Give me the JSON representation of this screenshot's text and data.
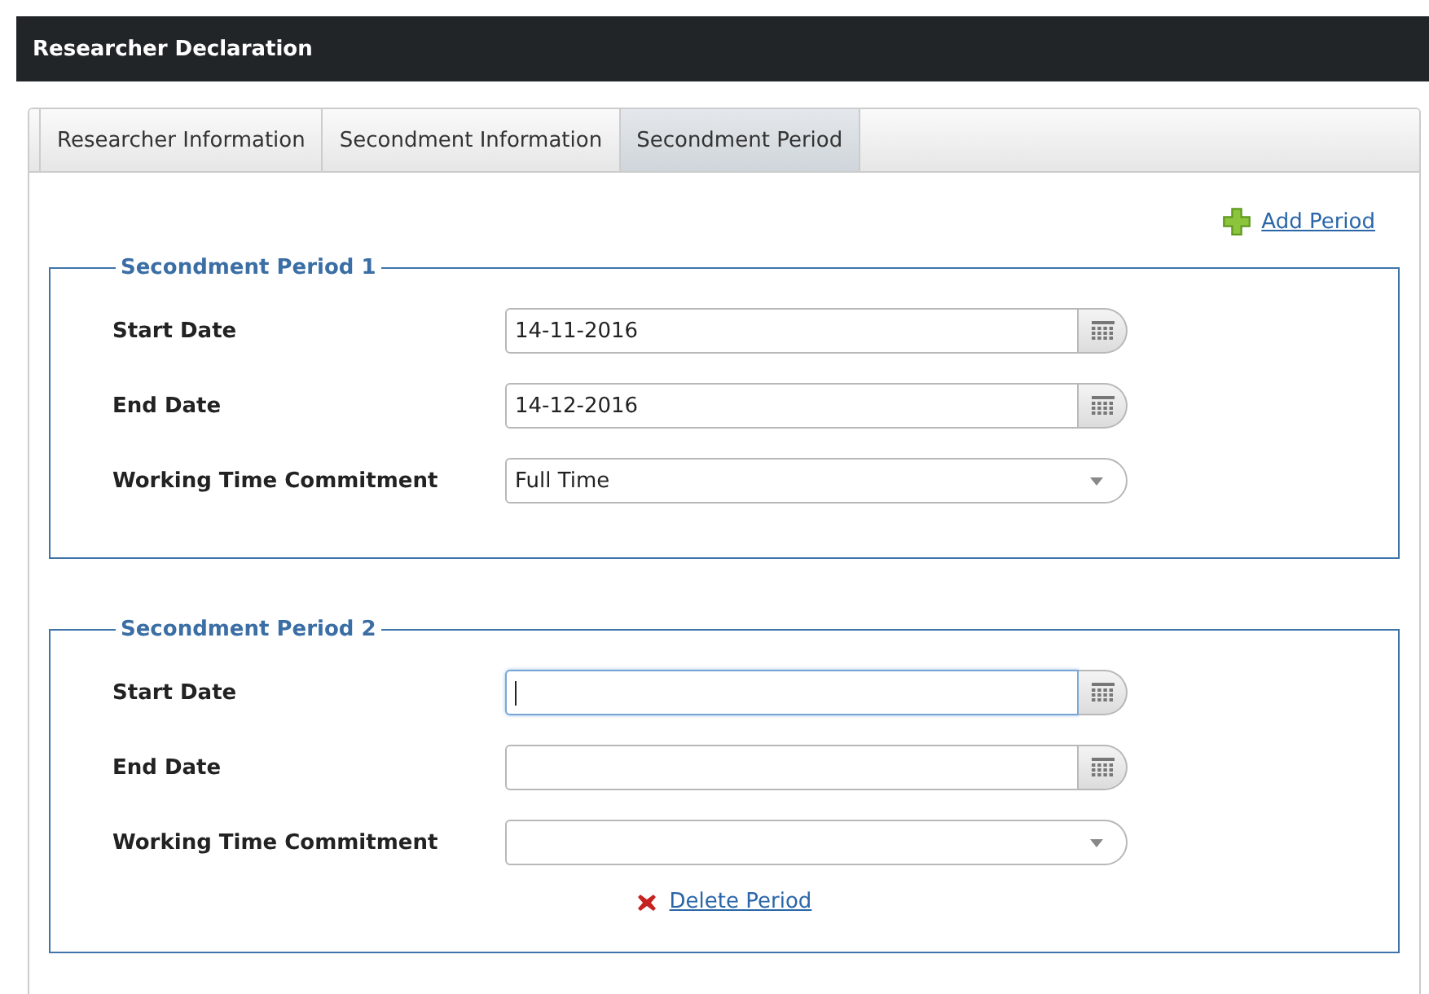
{
  "header": {
    "title": "Researcher Declaration"
  },
  "tabs": [
    {
      "label": "Researcher Information",
      "selected": false
    },
    {
      "label": "Secondment Information",
      "selected": false
    },
    {
      "label": "Secondment Period",
      "selected": true
    }
  ],
  "add_link": "Add Period",
  "periods": [
    {
      "title": "Secondment Period 1",
      "fields": [
        {
          "kind": "date",
          "label": "Start Date",
          "value": "14-11-2016",
          "focused": false
        },
        {
          "kind": "date",
          "label": "End Date",
          "value": "14-12-2016",
          "focused": false
        },
        {
          "kind": "select",
          "label": "Working Time Commitment",
          "value": "Full Time",
          "focused": false
        }
      ]
    },
    {
      "title": "Secondment Period 2",
      "fields": [
        {
          "kind": "date",
          "label": "Start Date",
          "focused": true
        },
        {
          "kind": "date",
          "label": "End Date",
          "focused": false
        },
        {
          "kind": "select",
          "label": "Working Time Commitment",
          "focused": false
        }
      ],
      "delete_link": "Delete Period"
    }
  ]
}
